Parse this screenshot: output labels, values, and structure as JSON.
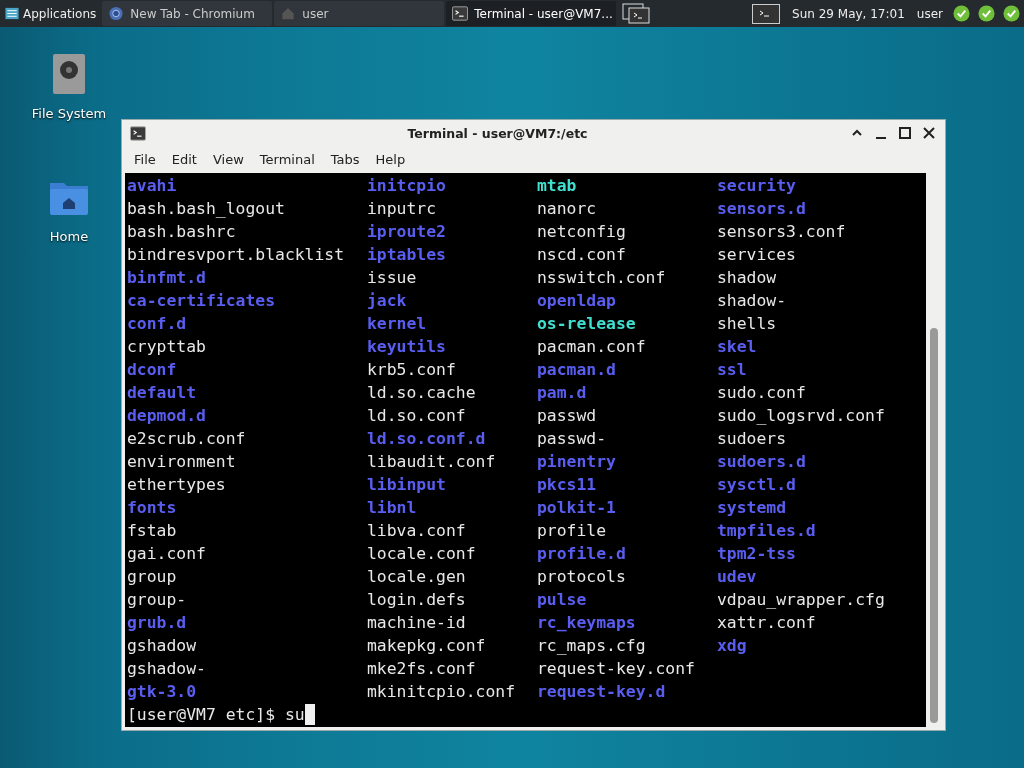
{
  "panel": {
    "menu_label": "Applications",
    "tasks": [
      {
        "label": "New Tab - Chromium",
        "kind": "browser",
        "selected": false
      },
      {
        "label": "user",
        "kind": "folder",
        "selected": false
      },
      {
        "label": "Terminal - user@VM7...",
        "kind": "terminal",
        "selected": true
      }
    ],
    "clock": "Sun 29 May, 17:01",
    "user": "user"
  },
  "desktop_icons": [
    {
      "label": "File System",
      "kind": "drive"
    },
    {
      "label": "Home",
      "kind": "home"
    }
  ],
  "window": {
    "title": "Terminal - user@VM7:/etc",
    "menu": [
      "File",
      "Edit",
      "View",
      "Terminal",
      "Tabs",
      "Help"
    ],
    "columns": [
      [
        {
          "name": "avahi",
          "kind": "dir"
        },
        {
          "name": "bash.bash_logout",
          "kind": "file"
        },
        {
          "name": "bash.bashrc",
          "kind": "file"
        },
        {
          "name": "bindresvport.blacklist",
          "kind": "file"
        },
        {
          "name": "binfmt.d",
          "kind": "dir"
        },
        {
          "name": "ca-certificates",
          "kind": "dir"
        },
        {
          "name": "conf.d",
          "kind": "dir"
        },
        {
          "name": "crypttab",
          "kind": "file"
        },
        {
          "name": "dconf",
          "kind": "dir"
        },
        {
          "name": "default",
          "kind": "dir"
        },
        {
          "name": "depmod.d",
          "kind": "dir"
        },
        {
          "name": "e2scrub.conf",
          "kind": "file"
        },
        {
          "name": "environment",
          "kind": "file"
        },
        {
          "name": "ethertypes",
          "kind": "file"
        },
        {
          "name": "fonts",
          "kind": "dir"
        },
        {
          "name": "fstab",
          "kind": "file"
        },
        {
          "name": "gai.conf",
          "kind": "file"
        },
        {
          "name": "group",
          "kind": "file"
        },
        {
          "name": "group-",
          "kind": "file"
        },
        {
          "name": "grub.d",
          "kind": "dir"
        },
        {
          "name": "gshadow",
          "kind": "file"
        },
        {
          "name": "gshadow-",
          "kind": "file"
        },
        {
          "name": "gtk-3.0",
          "kind": "dir"
        }
      ],
      [
        {
          "name": "initcpio",
          "kind": "dir"
        },
        {
          "name": "inputrc",
          "kind": "file"
        },
        {
          "name": "iproute2",
          "kind": "dir"
        },
        {
          "name": "iptables",
          "kind": "dir"
        },
        {
          "name": "issue",
          "kind": "file"
        },
        {
          "name": "jack",
          "kind": "dir"
        },
        {
          "name": "kernel",
          "kind": "dir"
        },
        {
          "name": "keyutils",
          "kind": "dir"
        },
        {
          "name": "krb5.conf",
          "kind": "file"
        },
        {
          "name": "ld.so.cache",
          "kind": "file"
        },
        {
          "name": "ld.so.conf",
          "kind": "file"
        },
        {
          "name": "ld.so.conf.d",
          "kind": "dir"
        },
        {
          "name": "libaudit.conf",
          "kind": "file"
        },
        {
          "name": "libinput",
          "kind": "dir"
        },
        {
          "name": "libnl",
          "kind": "dir"
        },
        {
          "name": "libva.conf",
          "kind": "file"
        },
        {
          "name": "locale.conf",
          "kind": "file"
        },
        {
          "name": "locale.gen",
          "kind": "file"
        },
        {
          "name": "login.defs",
          "kind": "file"
        },
        {
          "name": "machine-id",
          "kind": "file"
        },
        {
          "name": "makepkg.conf",
          "kind": "file"
        },
        {
          "name": "mke2fs.conf",
          "kind": "file"
        },
        {
          "name": "mkinitcpio.conf",
          "kind": "file"
        }
      ],
      [
        {
          "name": "mtab",
          "kind": "link"
        },
        {
          "name": "nanorc",
          "kind": "file"
        },
        {
          "name": "netconfig",
          "kind": "file"
        },
        {
          "name": "nscd.conf",
          "kind": "file"
        },
        {
          "name": "nsswitch.conf",
          "kind": "file"
        },
        {
          "name": "openldap",
          "kind": "dir"
        },
        {
          "name": "os-release",
          "kind": "link"
        },
        {
          "name": "pacman.conf",
          "kind": "file"
        },
        {
          "name": "pacman.d",
          "kind": "dir"
        },
        {
          "name": "pam.d",
          "kind": "dir"
        },
        {
          "name": "passwd",
          "kind": "file"
        },
        {
          "name": "passwd-",
          "kind": "file"
        },
        {
          "name": "pinentry",
          "kind": "dir"
        },
        {
          "name": "pkcs11",
          "kind": "dir"
        },
        {
          "name": "polkit-1",
          "kind": "dir"
        },
        {
          "name": "profile",
          "kind": "file"
        },
        {
          "name": "profile.d",
          "kind": "dir"
        },
        {
          "name": "protocols",
          "kind": "file"
        },
        {
          "name": "pulse",
          "kind": "dir"
        },
        {
          "name": "rc_keymaps",
          "kind": "dir"
        },
        {
          "name": "rc_maps.cfg",
          "kind": "file"
        },
        {
          "name": "request-key.conf",
          "kind": "file"
        },
        {
          "name": "request-key.d",
          "kind": "dir"
        }
      ],
      [
        {
          "name": "security",
          "kind": "dir"
        },
        {
          "name": "sensors.d",
          "kind": "dir"
        },
        {
          "name": "sensors3.conf",
          "kind": "file"
        },
        {
          "name": "services",
          "kind": "file"
        },
        {
          "name": "shadow",
          "kind": "file"
        },
        {
          "name": "shadow-",
          "kind": "file"
        },
        {
          "name": "shells",
          "kind": "file"
        },
        {
          "name": "skel",
          "kind": "dir"
        },
        {
          "name": "ssl",
          "kind": "dir"
        },
        {
          "name": "sudo.conf",
          "kind": "file"
        },
        {
          "name": "sudo_logsrvd.conf",
          "kind": "file"
        },
        {
          "name": "sudoers",
          "kind": "file"
        },
        {
          "name": "sudoers.d",
          "kind": "dir"
        },
        {
          "name": "sysctl.d",
          "kind": "dir"
        },
        {
          "name": "systemd",
          "kind": "dir"
        },
        {
          "name": "tmpfiles.d",
          "kind": "dir"
        },
        {
          "name": "tpm2-tss",
          "kind": "dir"
        },
        {
          "name": "udev",
          "kind": "dir"
        },
        {
          "name": "vdpau_wrapper.cfg",
          "kind": "file"
        },
        {
          "name": "xattr.conf",
          "kind": "file"
        },
        {
          "name": "xdg",
          "kind": "dir"
        }
      ]
    ],
    "prompt": "[user@VM7 etc]$ ",
    "command": "su"
  }
}
